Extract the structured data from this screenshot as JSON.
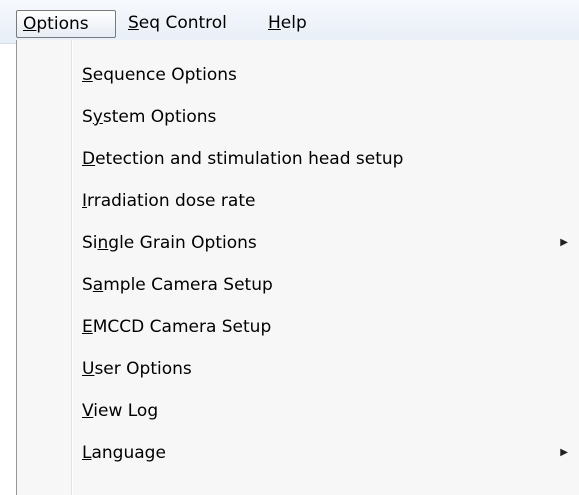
{
  "menubar": {
    "items": [
      {
        "label": "Options",
        "underline": "O"
      },
      {
        "label": "Seq Control",
        "underline": "S"
      },
      {
        "label": "Help",
        "underline": "H"
      }
    ],
    "active": "Options"
  },
  "dropdown": {
    "items": [
      {
        "label": "Sequence Options",
        "underline_index": 0,
        "submenu": false
      },
      {
        "label": "System Options",
        "underline_index": 1,
        "submenu": false
      },
      {
        "label": "Detection and stimulation head setup",
        "underline_index": 0,
        "submenu": false
      },
      {
        "label": "Irradiation dose rate",
        "underline_index": 0,
        "submenu": false
      },
      {
        "label": "Single Grain Options",
        "underline_index": 2,
        "submenu": true
      },
      {
        "label": "Sample Camera Setup",
        "underline_index": 1,
        "submenu": false
      },
      {
        "label": "EMCCD Camera Setup",
        "underline_index": 0,
        "submenu": false
      },
      {
        "label": "User Options",
        "underline_index": 0,
        "submenu": false
      },
      {
        "label": "View Log",
        "underline_index": 0,
        "submenu": false
      },
      {
        "label": "Language",
        "underline_index": 0,
        "submenu": true
      }
    ],
    "submenu_arrow": "▶"
  },
  "colors": {
    "menubar_bg": "#eef3fa",
    "menu_bg": "#f7f7f7",
    "text": "#000000"
  }
}
